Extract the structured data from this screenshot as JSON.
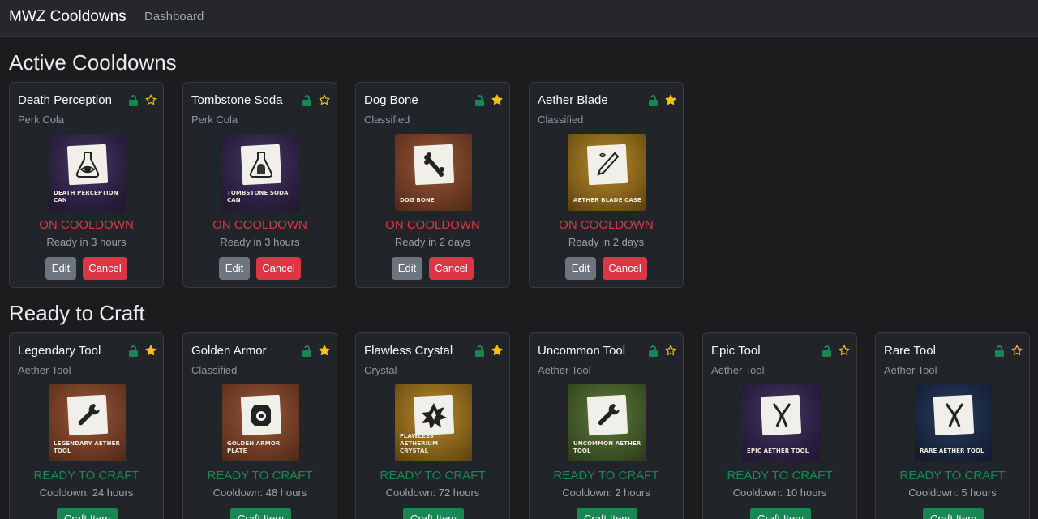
{
  "nav": {
    "brand": "MWZ Cooldowns",
    "link": "Dashboard"
  },
  "colors": {
    "on_cooldown": "#dc3545",
    "ready": "#198754",
    "star": "#ffc107",
    "lock": "#198754"
  },
  "active": {
    "title": "Active Cooldowns",
    "edit_label": "Edit",
    "cancel_label": "Cancel",
    "cards": [
      {
        "name": "Death Perception",
        "category": "Perk Cola",
        "caption": "DEATH PERCEPTION CAN",
        "status": "ON COOLDOWN",
        "detail": "Ready in 3 hours",
        "starred": false,
        "icon": "flask-eye-icon"
      },
      {
        "name": "Tombstone Soda",
        "category": "Perk Cola",
        "caption": "TOMBSTONE SODA CAN",
        "status": "ON COOLDOWN",
        "detail": "Ready in 3 hours",
        "starred": false,
        "icon": "flask-tombstone-icon"
      },
      {
        "name": "Dog Bone",
        "category": "Classified",
        "caption": "DOG BONE",
        "status": "ON COOLDOWN",
        "detail": "Ready in 2 days",
        "starred": true,
        "icon": "bone-icon"
      },
      {
        "name": "Aether Blade",
        "category": "Classified",
        "caption": "AETHER BLADE CASE",
        "status": "ON COOLDOWN",
        "detail": "Ready in 2 days",
        "starred": true,
        "icon": "blade-icon"
      }
    ]
  },
  "ready": {
    "title": "Ready to Craft",
    "craft_label": "Craft Item",
    "cards": [
      {
        "name": "Legendary Tool",
        "category": "Aether Tool",
        "caption": "LEGENDARY AETHER TOOL",
        "status": "READY TO CRAFT",
        "detail": "Cooldown: 24 hours",
        "starred": true,
        "icon": "wrench-icon"
      },
      {
        "name": "Golden Armor",
        "category": "Classified",
        "caption": "GOLDEN ARMOR PLATE",
        "status": "READY TO CRAFT",
        "detail": "Cooldown: 48 hours",
        "starred": true,
        "icon": "armor-plate-icon"
      },
      {
        "name": "Flawless Crystal",
        "category": "Crystal",
        "caption": "FLAWLESS AETHERIUM CRYSTAL",
        "status": "READY TO CRAFT",
        "detail": "Cooldown: 72 hours",
        "starred": true,
        "icon": "crystal-icon"
      },
      {
        "name": "Uncommon Tool",
        "category": "Aether Tool",
        "caption": "UNCOMMON AETHER TOOL",
        "status": "READY TO CRAFT",
        "detail": "Cooldown: 2 hours",
        "starred": false,
        "icon": "wrench-icon"
      },
      {
        "name": "Epic Tool",
        "category": "Aether Tool",
        "caption": "EPIC AETHER TOOL",
        "status": "READY TO CRAFT",
        "detail": "Cooldown: 10 hours",
        "starred": false,
        "icon": "pliers-icon"
      },
      {
        "name": "Rare Tool",
        "category": "Aether Tool",
        "caption": "RARE AETHER TOOL",
        "status": "READY TO CRAFT",
        "detail": "Cooldown: 5 hours",
        "starred": false,
        "icon": "pliers-icon"
      }
    ]
  }
}
